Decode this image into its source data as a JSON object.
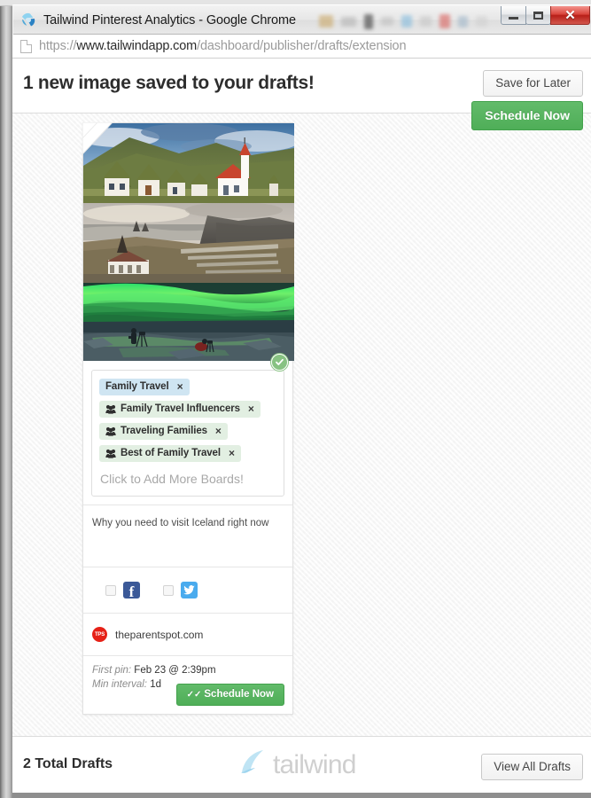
{
  "window": {
    "title": "Tailwind Pinterest Analytics - Google Chrome",
    "app_icon": "chrome-icon",
    "minimize_label": "",
    "maximize_label": "",
    "close_label": "✕"
  },
  "url_bar": {
    "icon": "page-icon",
    "scheme": "https://",
    "domain": "www.tailwindapp.com",
    "path": "/dashboard/publisher/drafts/extension"
  },
  "header": {
    "title": "1 new image saved to your drafts!",
    "save_for_later_label": "Save for Later",
    "schedule_now_label": "Schedule Now"
  },
  "card": {
    "images": [
      {
        "alt": "iceland-turf-houses-church",
        "name": "pin-photo-turf-houses"
      },
      {
        "alt": "iceland-coastal-cliffs-village",
        "name": "pin-photo-coastal-village"
      },
      {
        "alt": "iceland-aurora-borealis-photographers",
        "name": "pin-photo-aurora"
      }
    ],
    "check_badge": "✓",
    "boards": [
      {
        "label": "Family Travel",
        "type": "personal",
        "remove": "×"
      },
      {
        "label": "Family Travel Influencers",
        "type": "group",
        "remove": "×"
      },
      {
        "label": "Traveling Families",
        "type": "group",
        "remove": "×"
      },
      {
        "label": "Best of Family Travel",
        "type": "group",
        "remove": "×"
      }
    ],
    "add_boards_placeholder": "Click to Add More Boards!",
    "description": "Why you need to visit Iceland right now",
    "social": {
      "facebook_label": "f",
      "facebook_icon": "facebook-icon",
      "twitter_icon": "twitter-icon"
    },
    "source": {
      "avatar_text": "TPS",
      "domain": "theparentspot.com"
    },
    "schedule": {
      "first_pin_label": "First pin:",
      "first_pin_value": "Feb 23 @ 2:39pm",
      "min_interval_label": "Min interval:",
      "min_interval_value": "1d",
      "schedule_button_label": "Schedule Now",
      "schedule_button_check": "✓✓"
    }
  },
  "footer": {
    "total_drafts": "2 Total Drafts",
    "brand": "tailwind",
    "view_all_label": "View All Drafts"
  },
  "colors": {
    "green_primary": "#53b05c",
    "chip_personal": "#cfe5f2",
    "chip_group": "#e2efe2",
    "facebook": "#3b5998",
    "twitter": "#4aabee",
    "source_avatar": "#e62117",
    "brand_gray": "#cfcfcf",
    "brand_blue": "#b8e0f0"
  }
}
